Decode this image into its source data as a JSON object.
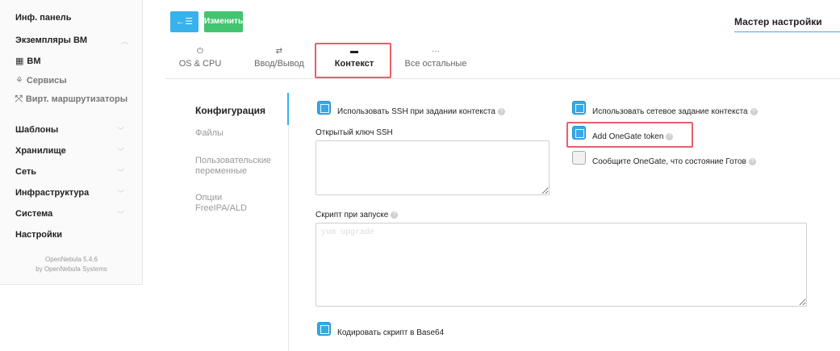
{
  "sidebar": {
    "items": [
      {
        "label": "Инф. панель"
      },
      {
        "label": "Экземпляры ВМ"
      },
      {
        "label": "ВМ"
      },
      {
        "label": "Сервисы"
      },
      {
        "label": "Вирт. маршрутизаторы"
      },
      {
        "label": "Шаблоны"
      },
      {
        "label": "Хранилище"
      },
      {
        "label": "Сеть"
      },
      {
        "label": "Инфраструктура"
      },
      {
        "label": "Система"
      },
      {
        "label": "Настройки"
      }
    ],
    "footer_line1": "OpenNebula 5.4.6",
    "footer_line2": "by OpenNebula Systems"
  },
  "toolbar": {
    "back_label": "←☰",
    "edit_label": "Изменить",
    "wizard_label": "Мастер настройки"
  },
  "tabs": [
    {
      "icon": "⏻",
      "label": "OS & CPU"
    },
    {
      "icon": "⇄",
      "label": "Ввод/Вывод"
    },
    {
      "icon": "▬",
      "label": "Контекст"
    },
    {
      "icon": "···",
      "label": "Все остальные"
    }
  ],
  "vnav": [
    {
      "label": "Конфигурация"
    },
    {
      "label": "Файлы"
    },
    {
      "label": "Пользовательские переменные"
    },
    {
      "label": "Опции FreeIPA/ALD"
    }
  ],
  "form": {
    "ssh_context_label": "Использовать SSH при задании контекста",
    "network_context_label": "Использовать сетевое задание контекста",
    "onegate_token_label": "Add OneGate token",
    "report_ready_label": "Сообщите OneGate, что состояние Готов",
    "ssh_key_label": "Открытый ключ SSH",
    "ssh_key_value": "",
    "start_script_label": "Скрипт при запуске",
    "start_script_placeholder": "yum upgrade",
    "base64_label": "Кодировать скрипт в Base64",
    "help_glyph": "?"
  }
}
